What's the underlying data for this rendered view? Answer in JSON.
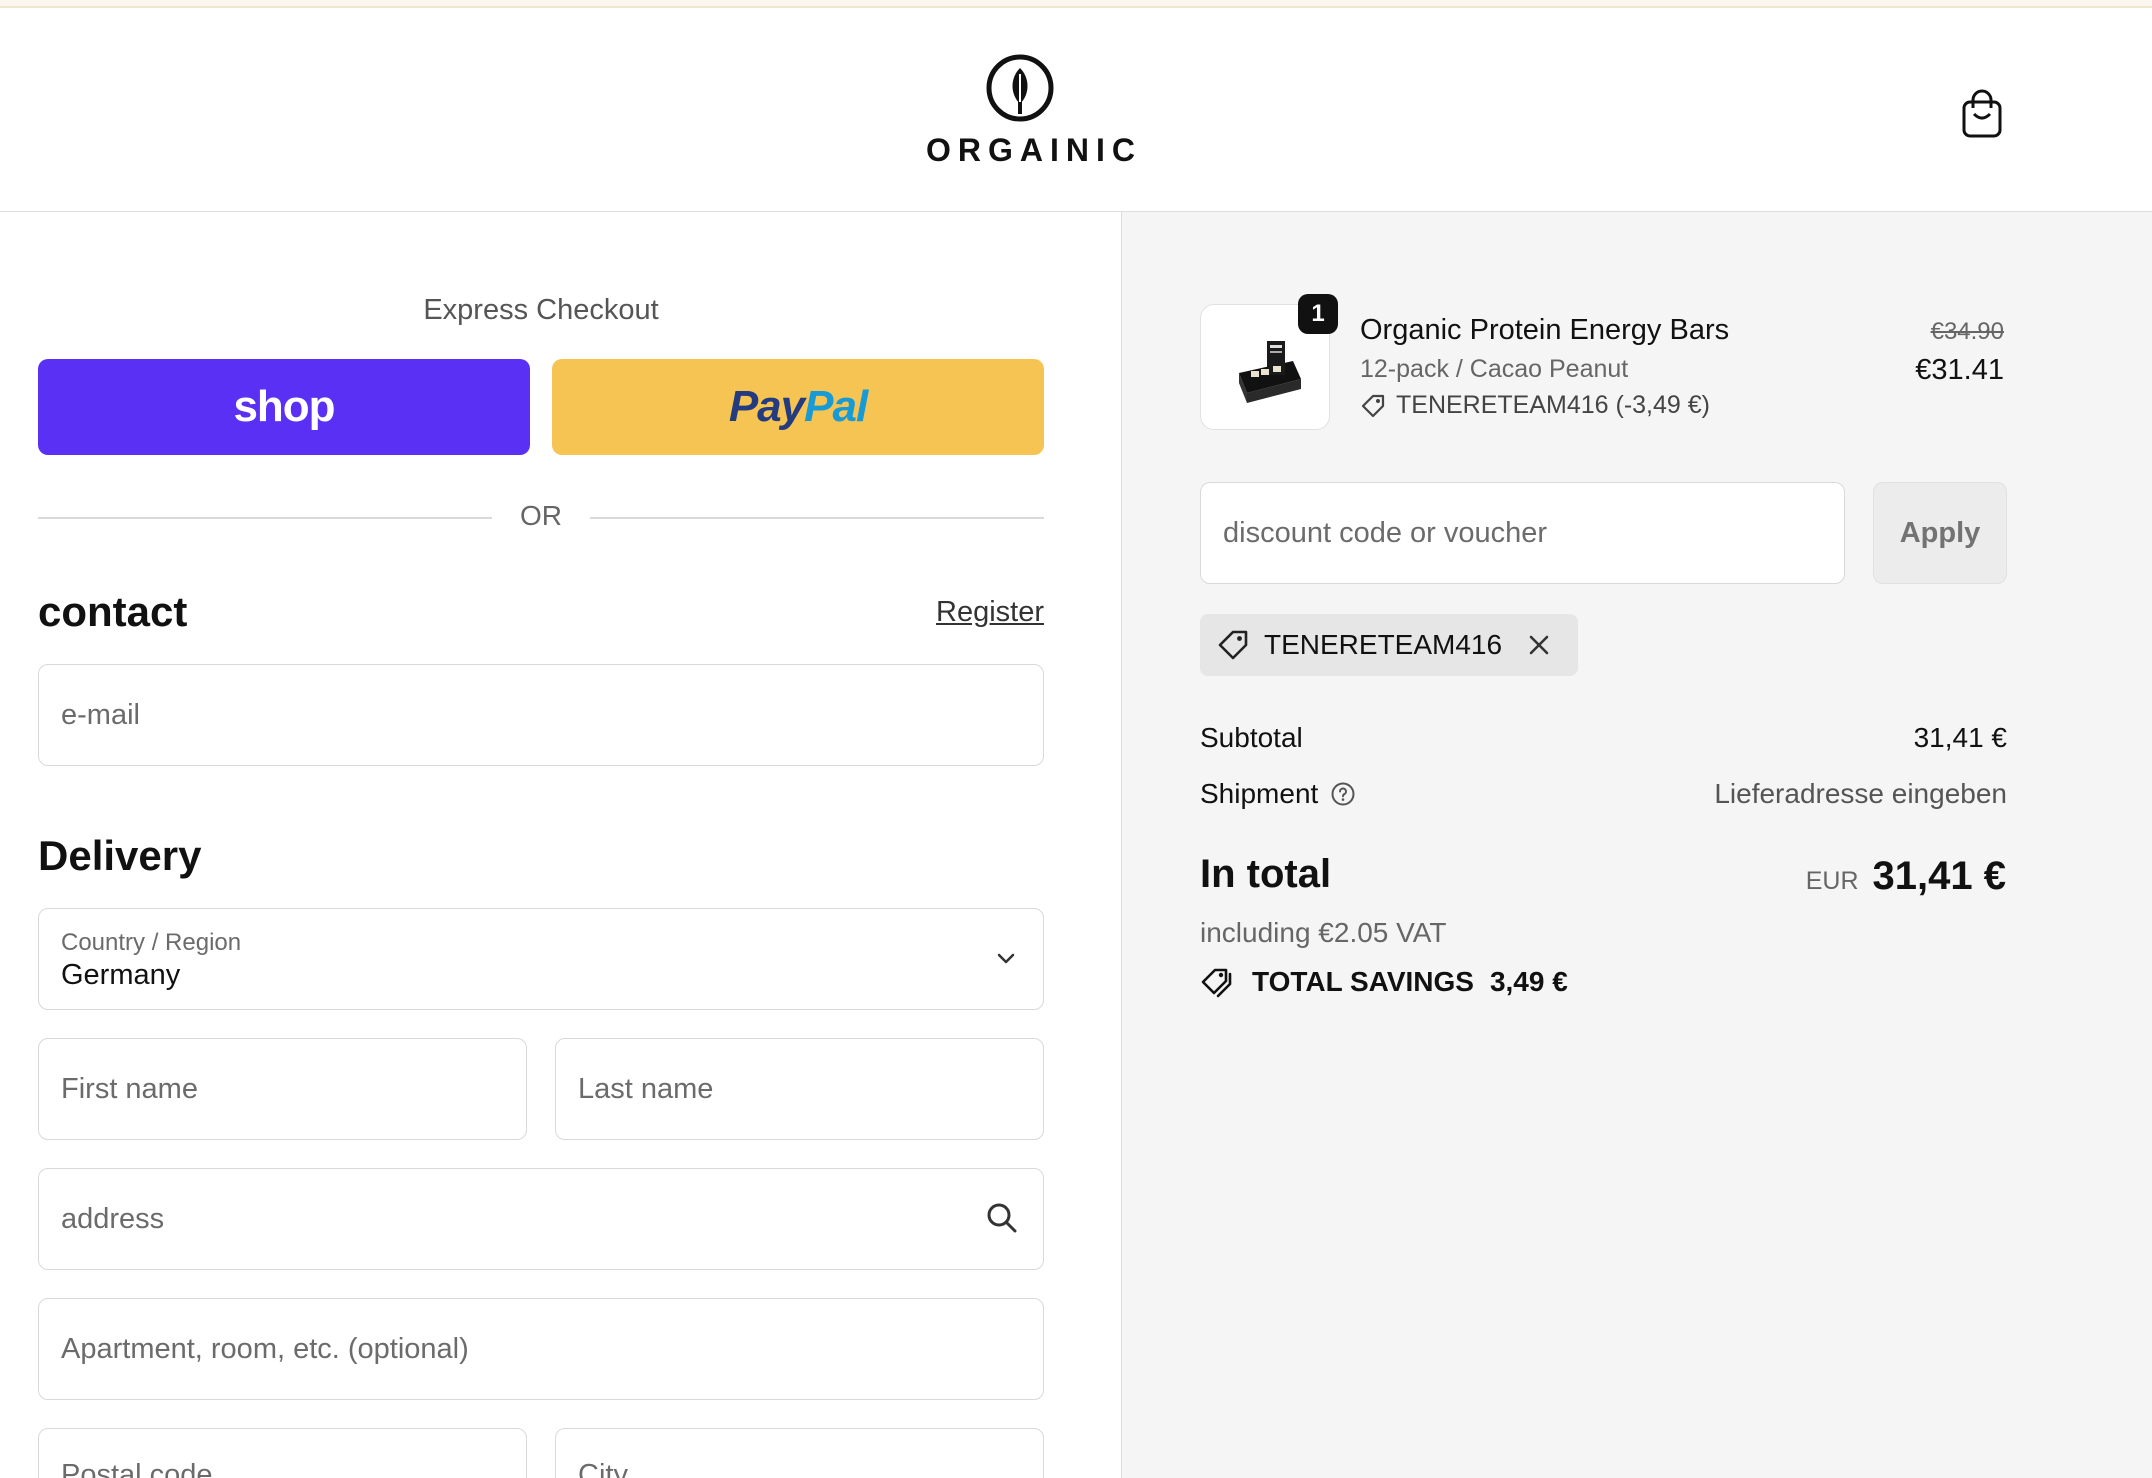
{
  "brand": {
    "name": "ORGAINIC"
  },
  "express": {
    "title": "Express Checkout",
    "shop_label": "shop",
    "paypal_a": "Pay",
    "paypal_b": "Pal",
    "or": "OR"
  },
  "contact": {
    "title": "contact",
    "register": "Register",
    "email_placeholder": "e-mail"
  },
  "delivery": {
    "title": "Delivery",
    "country_label": "Country / Region",
    "country_value": "Germany",
    "first_name": "First name",
    "last_name": "Last name",
    "address": "address",
    "apartment": "Apartment, room, etc. (optional)",
    "postal_code": "Postal code",
    "city": "City"
  },
  "order": {
    "quantity": "1",
    "product_name": "Organic Protein Energy Bars",
    "variant": "12-pack / Cacao Peanut",
    "discount_line": "TENERETEAM416 (-3,49 €)",
    "old_price": "€34.90",
    "new_price": "€31.41",
    "discount_placeholder": "discount code or voucher",
    "apply": "Apply",
    "applied_code": "TENERETEAM416",
    "subtotal_label": "Subtotal",
    "subtotal_value": "31,41 €",
    "shipment_label": "Shipment",
    "shipment_value": "Lieferadresse eingeben",
    "total_label": "In total",
    "total_currency": "EUR",
    "total_value": "31,41 €",
    "vat": "including €2.05 VAT",
    "savings_label": "TOTAL SAVINGS",
    "savings_value": "3,49 €"
  },
  "colors": {
    "shop_purple": "#5a31f4",
    "paypal_yellow": "#f6c452",
    "summary_bg": "#f5f5f5"
  },
  "icons": [
    "orgainic-leaf-logo",
    "shopping-bag-icon",
    "chevron-down-icon",
    "search-icon",
    "tag-icon",
    "close-icon",
    "help-circle-icon",
    "savings-tags-icon"
  ]
}
